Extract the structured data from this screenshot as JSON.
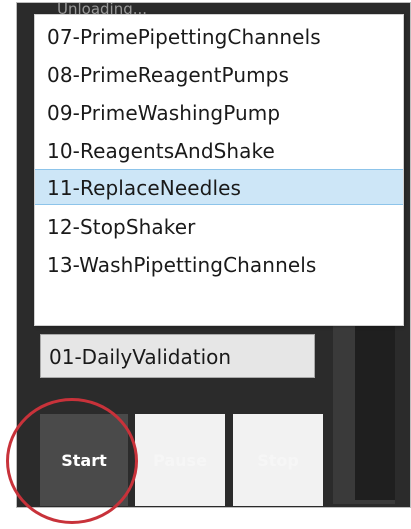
{
  "window": {
    "header_partial": "Unloading..."
  },
  "dropdown": {
    "items": [
      {
        "label": "07-PrimePipettingChannels",
        "selected": false
      },
      {
        "label": "08-PrimeReagentPumps",
        "selected": false
      },
      {
        "label": "09-PrimeWashingPump",
        "selected": false
      },
      {
        "label": "10-ReagentsAndShake",
        "selected": false
      },
      {
        "label": "11-ReplaceNeedles",
        "selected": true
      },
      {
        "label": "12-StopShaker",
        "selected": false
      },
      {
        "label": "13-WashPipettingChannels",
        "selected": false
      }
    ]
  },
  "combo": {
    "value": "01-DailyValidation"
  },
  "buttons": {
    "start_label": "Start",
    "pause_label": "Pause",
    "stop_label": "Stop"
  },
  "colors": {
    "selection_bg": "#cde6f7",
    "annotation_circle": "#c8323a",
    "start_button_bg": "#4a4a4a",
    "panel_bg": "#2b2b2b"
  }
}
